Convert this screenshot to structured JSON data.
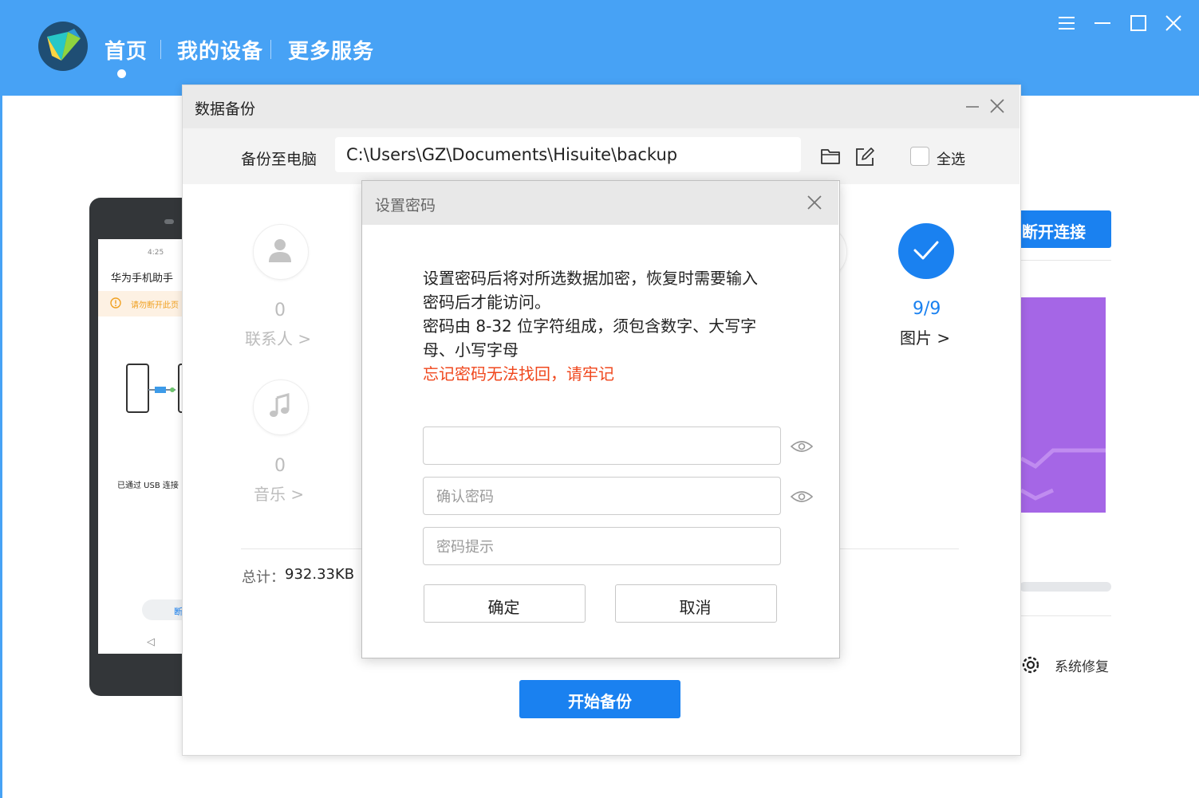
{
  "nav": {
    "items": [
      {
        "label": "首页",
        "active": true
      },
      {
        "label": "我的设备"
      },
      {
        "label": "更多服务"
      }
    ]
  },
  "window_controls": [
    "menu-icon",
    "minimize-icon",
    "maximize-icon",
    "close-icon"
  ],
  "phone_preview": {
    "time": "4:25",
    "app_title": "华为手机助手",
    "warning": "请勿断开此页",
    "usb_status": "已通过 USB 连接",
    "pill_text": "断"
  },
  "side": {
    "disconnect_label": "断开连接",
    "system_repair_label": "系统修复"
  },
  "backup_dialog": {
    "title": "数据备份",
    "path_label": "备份至电脑",
    "path_value": "C:\\Users\\GZ\\Documents\\Hisuite\\backup",
    "select_all_label": "全选",
    "categories": [
      {
        "name": "联系人 >",
        "count": "0",
        "icon": "person-icon"
      },
      {
        "name": "音乐 >",
        "count": "0",
        "icon": "music-note-icon"
      },
      {
        "name": "图片 >",
        "count": "9/9",
        "icon": "check-icon",
        "selected": true
      }
    ],
    "total_label": "总计：",
    "total_value": "932.33KB",
    "start_button": "开始备份"
  },
  "password_dialog": {
    "title": "设置密码",
    "description_lines": [
      "设置密码后将对所选数据加密，恢复时需要输入",
      "密码后才能访问。",
      "密码由 8-32 位字符组成，须包含数字、大写字",
      "母、小写字母"
    ],
    "warning": "忘记密码无法找回，请牢记",
    "password_value": "",
    "confirm_placeholder": "确认密码",
    "hint_placeholder": "密码提示",
    "ok_label": "确定",
    "cancel_label": "取消"
  },
  "colors": {
    "header_blue": "#47a2f5",
    "primary_blue": "#1a81f0",
    "warning_red": "#f0471d",
    "purple": "#a566e6"
  }
}
